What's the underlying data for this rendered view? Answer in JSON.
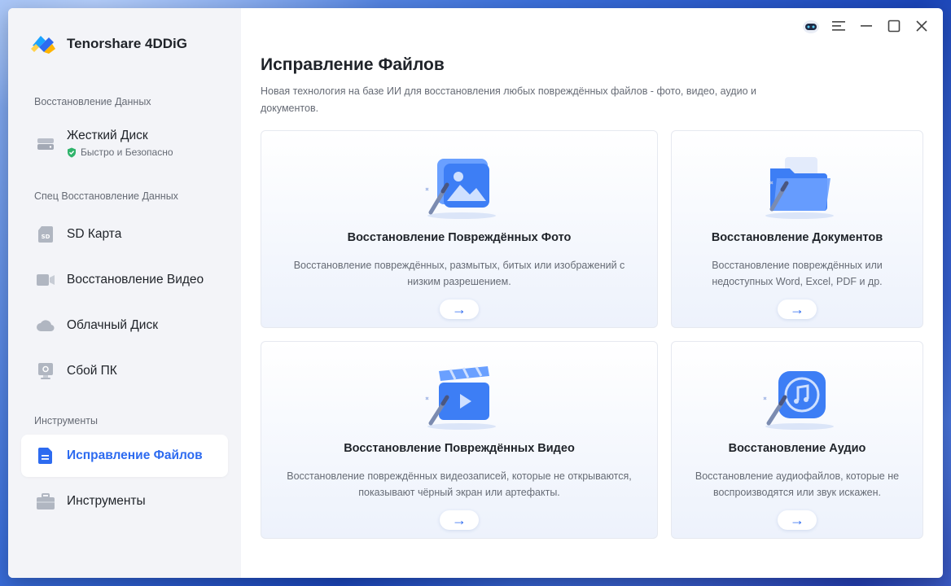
{
  "app": {
    "name": "Tenorshare 4DDiG"
  },
  "sidebar": {
    "sections": [
      {
        "label": "Восстановление Данных"
      },
      {
        "label": "Спец Восстановление Данных"
      },
      {
        "label": "Инструменты"
      }
    ],
    "items": [
      {
        "label": "Жесткий Диск",
        "sub": "Быстро и Безопасно",
        "icon": "hard-drive-icon"
      },
      {
        "label": "SD Карта",
        "icon": "sd-card-icon"
      },
      {
        "label": "Восстановление Видео",
        "icon": "video-camera-icon"
      },
      {
        "label": "Облачный Диск",
        "icon": "cloud-icon"
      },
      {
        "label": "Сбой ПК",
        "icon": "pc-crash-icon"
      },
      {
        "label": "Исправление Файлов",
        "icon": "file-repair-icon",
        "active": true
      },
      {
        "label": "Инструменты",
        "icon": "toolbox-icon"
      }
    ]
  },
  "main": {
    "title": "Исправление Файлов",
    "description": "Новая технология на базе ИИ для восстановления любых повреждённых файлов - фото, видео, аудио и документов.",
    "cards": [
      {
        "title": "Восстановление Повреждённых Фото",
        "desc": "Восстановление повреждённых, размытых, битых или изображений с низким разрешением.",
        "icon": "photo-repair-icon"
      },
      {
        "title": "Восстановление Документов",
        "desc": "Восстановление повреждённых или недоступных Word, Excel, PDF и др.",
        "icon": "document-folder-icon"
      },
      {
        "title": "Восстановление Повреждённых Видео",
        "desc": "Восстановление повреждённых видеозаписей, которые не открываются, показывают чёрный экран или артефакты.",
        "icon": "video-repair-icon"
      },
      {
        "title": "Восстановление Аудио",
        "desc": "Восстановление аудиофайлов, которые не воспроизводятся или звук искажен.",
        "icon": "audio-repair-icon"
      }
    ],
    "arrow": "→"
  },
  "colors": {
    "accent": "#2d6bf0",
    "sidebar_bg": "#f3f4f8",
    "text": "#1f2329",
    "muted": "#666b75"
  }
}
